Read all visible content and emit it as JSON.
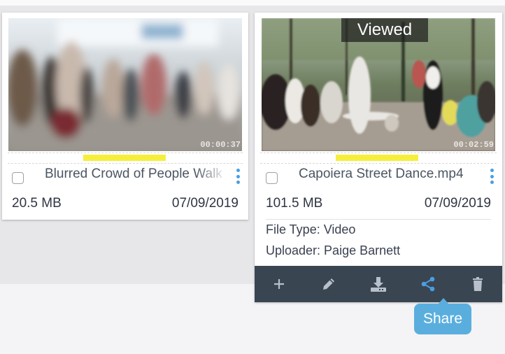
{
  "colors": {
    "accent": "#4a9fe0",
    "progress": "#f5ef3c",
    "action_bar": "#3a4552",
    "tooltip": "#5aaede"
  },
  "files": [
    {
      "name": "Blurred Crowd of People Walk",
      "duration": "00:00:37",
      "size": "20.5 MB",
      "date": "07/09/2019",
      "progress_fraction": 0.35,
      "viewed": false
    },
    {
      "name": "Capoiera Street Dance.mp4",
      "duration": "00:02:59",
      "size": "101.5 MB",
      "date": "07/09/2019",
      "progress_fraction": 0.35,
      "viewed_label": "Viewed",
      "file_type": "File Type: Video",
      "uploader": "Uploader: Paige Barnett",
      "actions": [
        {
          "icon": "plus-icon"
        },
        {
          "icon": "pencil-icon"
        },
        {
          "icon": "download-icon"
        },
        {
          "icon": "share-icon"
        },
        {
          "icon": "trash-icon"
        }
      ]
    }
  ],
  "tooltip": {
    "label": "Share"
  }
}
